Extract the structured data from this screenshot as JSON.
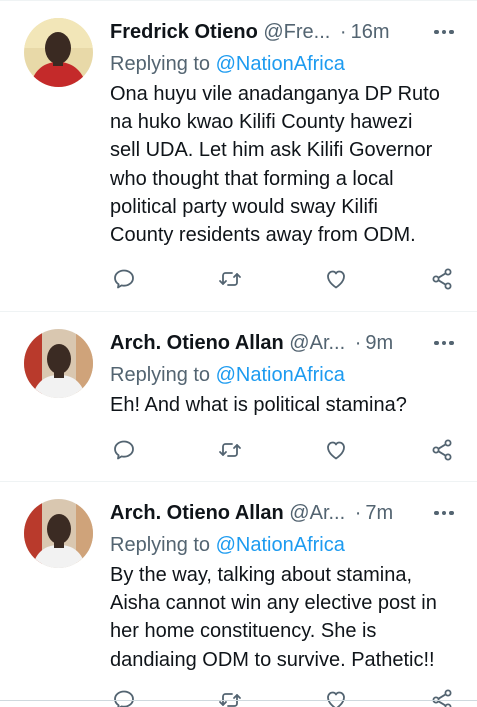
{
  "colors": {
    "text_primary": "#0f1419",
    "text_secondary": "#536471",
    "link": "#1d9bf0",
    "divider": "#eff3f4"
  },
  "tweets": [
    {
      "name": "Fredrick Otieno",
      "handle": "@Fre...",
      "separator": "·",
      "time": "16m",
      "replying_prefix": "Replying to",
      "replying_to": "@NationAfrica",
      "text_lines": [
        "Ona huyu vile anadanganya DP Ruto",
        "na huko kwao Kilifi County hawezi",
        "sell UDA. Let him ask Kilifi Governor",
        "who thought that forming a local",
        "political party would sway Kilifi",
        "County residents away from ODM."
      ],
      "avatar_icon": "user-avatar"
    },
    {
      "name": "Arch. Otieno Allan",
      "handle": "@Ar...",
      "separator": "·",
      "time": "9m",
      "replying_prefix": "Replying to",
      "replying_to": "@NationAfrica",
      "text_lines": [
        "Eh! And what is political stamina?"
      ],
      "avatar_icon": "user-avatar"
    },
    {
      "name": "Arch. Otieno Allan",
      "handle": "@Ar...",
      "separator": "·",
      "time": "7m",
      "replying_prefix": "Replying to",
      "replying_to": "@NationAfrica",
      "text_lines": [
        "By the way, talking about stamina,",
        "Aisha cannot win any elective post in",
        "her home constituency. She is",
        "dandiaing ODM to survive. Pathetic!!"
      ],
      "avatar_icon": "user-avatar"
    }
  ],
  "action_icons": [
    "reply-icon",
    "retweet-icon",
    "like-icon",
    "share-icon"
  ]
}
